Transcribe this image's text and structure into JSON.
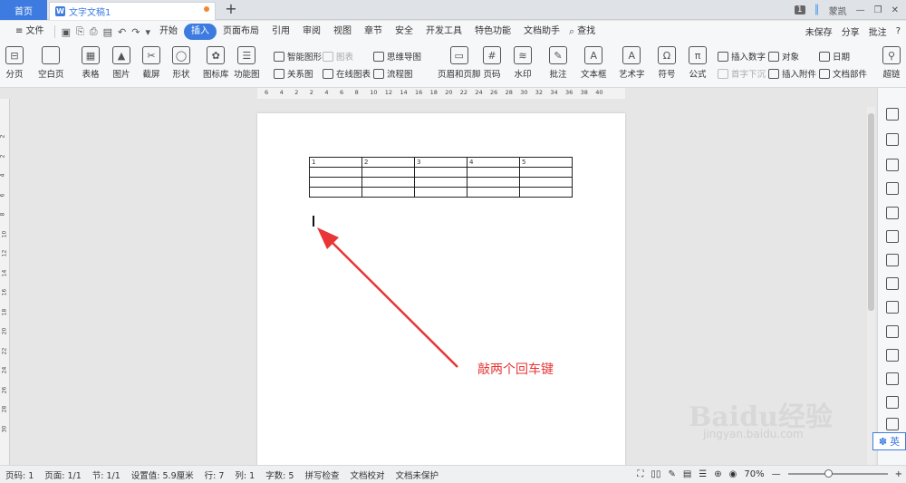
{
  "titlebar": {
    "home_tab": "首页",
    "doc_tab": "文字文稿1",
    "page_badge": "1",
    "user": "蒙凯"
  },
  "menu": {
    "file": "≡ 文件",
    "tabs": [
      "开始",
      "插入",
      "页面布局",
      "引用",
      "审阅",
      "视图",
      "章节",
      "安全",
      "开发工具",
      "特色功能",
      "文档助手"
    ],
    "active": "插入",
    "search": "查找",
    "right": [
      "未保存",
      "分享",
      "批注",
      "?"
    ]
  },
  "ribbon": {
    "big": [
      "分页",
      "空白页",
      "表格",
      "图片",
      "截屏",
      "形状",
      "图标库",
      "功能图",
      "页眉和页脚",
      "页码",
      "水印",
      "批注",
      "文本框",
      "艺术字",
      "符号",
      "公式",
      "超链"
    ],
    "small": [
      "智能图形",
      "图表",
      "思维导图",
      "关系图",
      "在线图表",
      "流程图",
      "插入数字",
      "对象",
      "日期",
      "首字下沉",
      "插入附件",
      "文档部件"
    ]
  },
  "ruler": {
    "ticks": [
      "6",
      "4",
      "2",
      "2",
      "4",
      "6",
      "8",
      "10",
      "12",
      "14",
      "16",
      "18",
      "20",
      "22",
      "24",
      "26",
      "28",
      "30",
      "32",
      "34",
      "36",
      "38",
      "40"
    ]
  },
  "vruler": {
    "ticks": [
      "2",
      "2",
      "4",
      "6",
      "8",
      "10",
      "12",
      "14",
      "16",
      "18",
      "20",
      "22",
      "24",
      "26",
      "28",
      "30"
    ]
  },
  "document": {
    "table": {
      "header": [
        "1",
        "2",
        "3",
        "4",
        "5"
      ],
      "empty_rows": 3
    }
  },
  "annotation": {
    "text": "敲两个回车键",
    "color": "#e83535"
  },
  "watermark": {
    "brand": "Baidu经验",
    "url": "jingyan.baidu.com"
  },
  "ime": {
    "label": "英"
  },
  "status": {
    "items": [
      "页码: 1",
      "页面: 1/1",
      "节: 1/1",
      "设置值: 5.9厘米",
      "行: 7",
      "列: 1",
      "字数: 5",
      "拼写检查",
      "文档校对",
      "文档未保护"
    ],
    "zoom": "70%"
  },
  "colors": {
    "accent": "#3d7be0",
    "annotation": "#e83535"
  }
}
